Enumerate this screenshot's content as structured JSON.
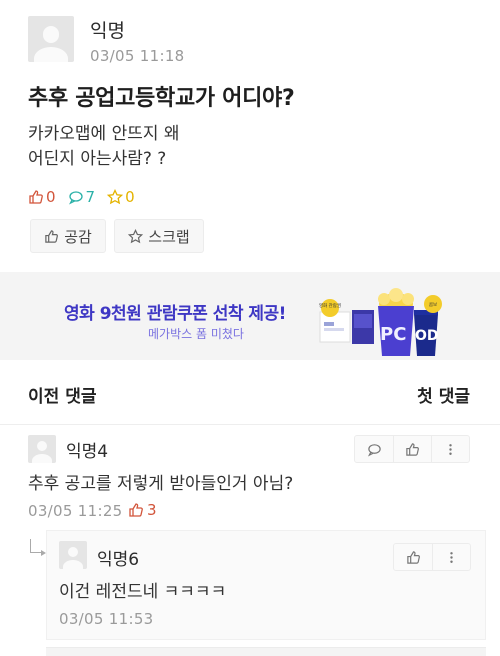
{
  "post": {
    "author": "익명",
    "time": "03/05 11:18",
    "title": "추후 공업고등학교가 어디야?",
    "body_line1": "카카오맵에 안뜨지 왜",
    "body_line2": "어딘지 아는사람? ?",
    "likes": "0",
    "comments": "7",
    "scraps": "0",
    "like_button": "공감",
    "scrap_button": "스크랩"
  },
  "ad": {
    "headline": "영화 9천원 관람쿠폰 선착 제공!",
    "sub": "메가박스 폼 미쳤다",
    "label_1": "영화 관람권",
    "label_2": "콤보",
    "pc": "PC",
    "od": "OD"
  },
  "nav": {
    "prev_comments": "이전 댓글",
    "first_comment": "첫 댓글"
  },
  "comments": [
    {
      "author": "익명4",
      "body": "추후 공고를 저렇게 받아들인거 아님?",
      "time": "03/05 11:25",
      "likes": "3"
    },
    {
      "author": "익명6",
      "body": "이건 레전드네 ㅋㅋㅋㅋ",
      "time": "03/05 11:53"
    }
  ],
  "colors": {
    "like": "#d2553b",
    "comment": "#2bb1a8",
    "scrap": "#e4b300",
    "ad_text": "#3e37c4"
  },
  "icons": [
    "thumbs-up-icon",
    "speech-bubble-icon",
    "star-icon",
    "more-vertical-icon",
    "reply-arrow-icon"
  ]
}
